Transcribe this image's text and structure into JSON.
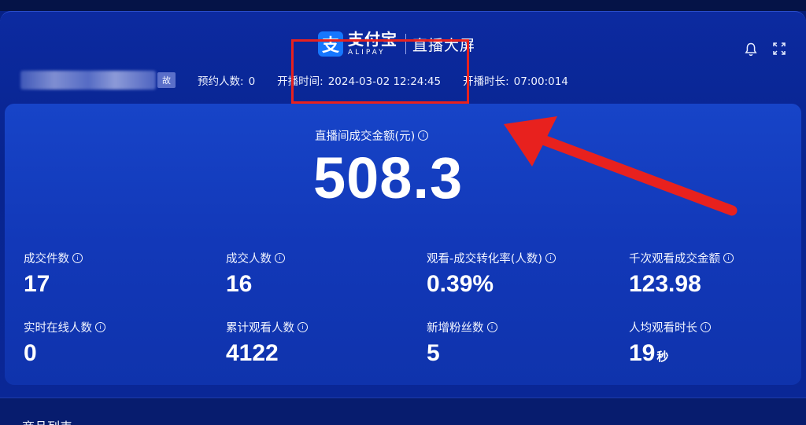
{
  "header": {
    "logo_cn": "支付宝",
    "logo_en": "ALIPAY",
    "subtitle": "直播大屏",
    "icons": [
      "bell-icon",
      "fullscreen-icon"
    ],
    "name_tag": "故"
  },
  "info": {
    "reservation_label": "预约人数:",
    "reservation_value": "0",
    "start_label": "开播时间:",
    "start_value": "2024-03-02 12:24:45",
    "duration_label": "开播时长:",
    "duration_value": "07:00:014"
  },
  "gmv": {
    "label": "直播间成交金额(元)",
    "value": "508.3"
  },
  "metrics": [
    {
      "label": "成交件数",
      "value": "17",
      "unit": ""
    },
    {
      "label": "成交人数",
      "value": "16",
      "unit": ""
    },
    {
      "label": "观看-成交转化率(人数)",
      "value": "0.39%",
      "unit": ""
    },
    {
      "label": "千次观看成交金额",
      "value": "123.98",
      "unit": ""
    },
    {
      "label": "实时在线人数",
      "value": "0",
      "unit": ""
    },
    {
      "label": "累计观看人数",
      "value": "4122",
      "unit": ""
    },
    {
      "label": "新增粉丝数",
      "value": "5",
      "unit": ""
    },
    {
      "label": "人均观看时长",
      "value": "19",
      "unit": "秒"
    }
  ],
  "bottom": {
    "title": "商品列表"
  },
  "colors": {
    "background": "#06228a",
    "card": "#1238b8",
    "annotation": "#e8211e",
    "brand": "#1677ff"
  }
}
